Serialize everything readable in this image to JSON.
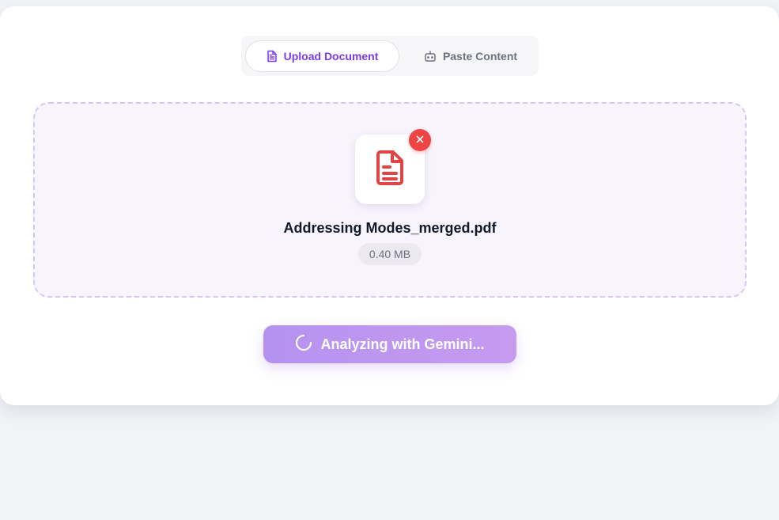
{
  "colors": {
    "accent": "#7c3aed",
    "danger": "#ef4444",
    "button_gradient_start": "#b592f0",
    "button_gradient_end": "#c79af0",
    "dropzone_bg": "#f8f4fd",
    "page_bg": "#f1f3f7"
  },
  "tabs": [
    {
      "label": "Upload Document",
      "icon": "document-icon",
      "active": true
    },
    {
      "label": "Paste Content",
      "icon": "robot-icon",
      "active": false
    }
  ],
  "upload": {
    "file_icon": "file-text-icon",
    "remove_icon": "close-icon",
    "file_name": "Addressing Modes_merged.pdf",
    "file_size": "0.40 MB"
  },
  "action": {
    "label": "Analyzing with Gemini...",
    "icon": "spinner-icon",
    "loading": true
  }
}
